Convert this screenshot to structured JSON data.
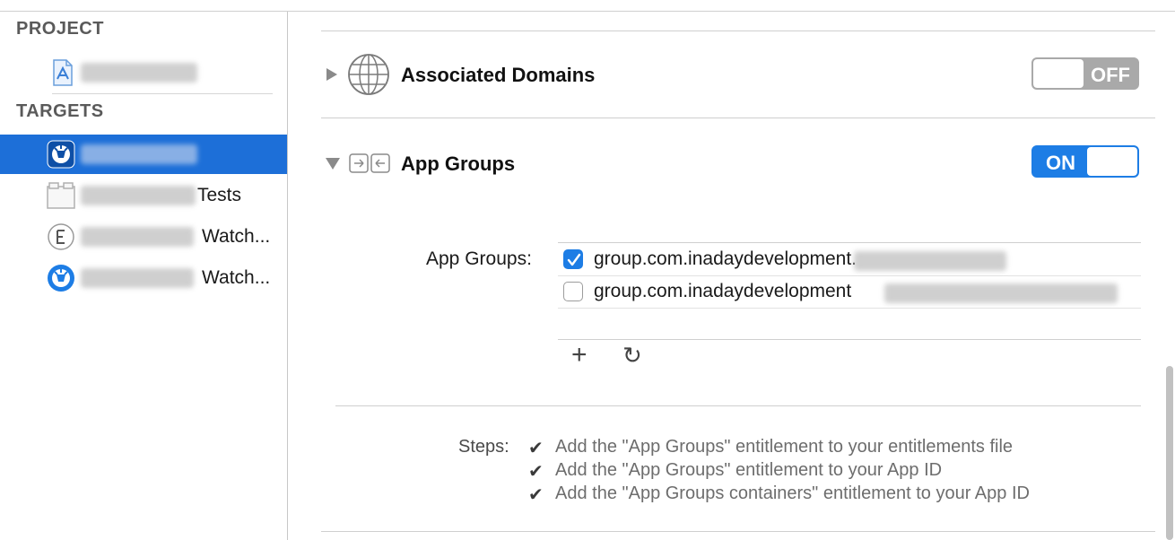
{
  "sidebar": {
    "project_header": "PROJECT",
    "targets_header": "TARGETS",
    "targets": [
      {
        "suffix": ""
      },
      {
        "suffix": "Tests"
      },
      {
        "suffix": "Watch..."
      },
      {
        "suffix": "Watch..."
      }
    ]
  },
  "capabilities": {
    "associated_domains": {
      "title": "Associated Domains",
      "toggle": "OFF"
    },
    "app_groups": {
      "title": "App Groups",
      "toggle": "ON",
      "field_label": "App Groups:",
      "groups": [
        {
          "text": "group.com.inadaydevelopment.",
          "checked": true
        },
        {
          "text": "group.com.inadaydevelopment",
          "checked": false
        }
      ],
      "add_label": "+",
      "refresh_label": "↻",
      "steps_label": "Steps:",
      "steps": [
        "Add the \"App Groups\" entitlement to your entitlements file",
        "Add the \"App Groups\" entitlement to your App ID",
        "Add the \"App Groups containers\" entitlement to your App ID"
      ],
      "step_mark": "✔"
    }
  },
  "colors": {
    "accent": "#1d7de5",
    "selection": "#1d6fd8"
  }
}
